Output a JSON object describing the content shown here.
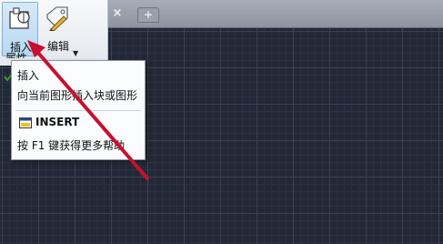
{
  "tabbar": {
    "close_glyph": "×",
    "new_tab_glyph": "+"
  },
  "ribbon": {
    "insert": {
      "label": "插入",
      "icon": "insert-block-icon"
    },
    "edit": {
      "label": "编辑",
      "label_line2": "属性",
      "icon": "edit-attribute-icon"
    }
  },
  "tooltip": {
    "title": "插入",
    "description": "向当前图形插入块或图形",
    "command": "INSERT",
    "help": "按 F1 键获得更多帮助"
  },
  "colors": {
    "annotation": "#c8102e",
    "canvas": "#222836",
    "ribbon_highlight": "#b7d8f2"
  }
}
